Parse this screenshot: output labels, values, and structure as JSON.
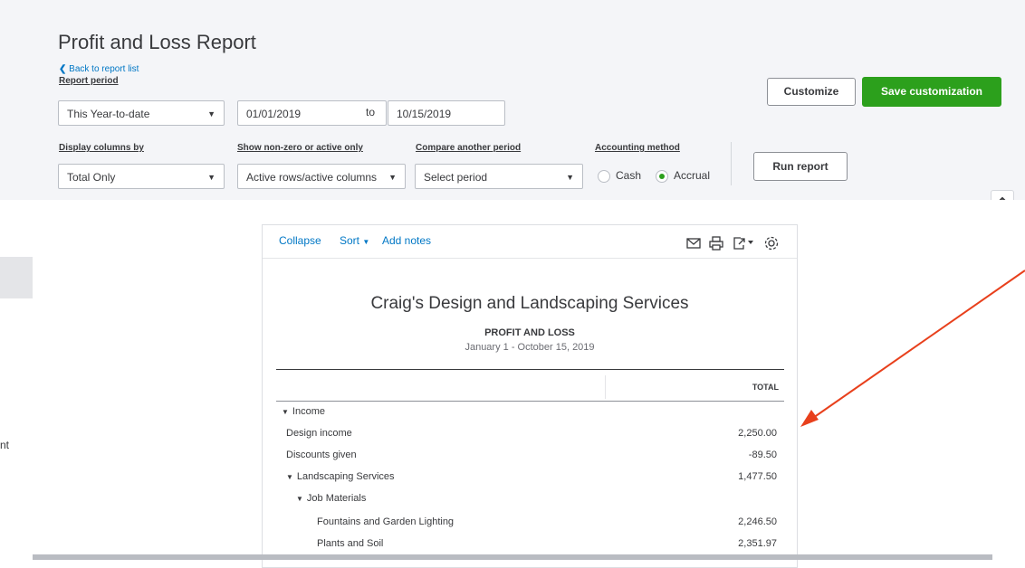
{
  "page": {
    "title": "Profit and Loss Report",
    "back_link": "Back to report list",
    "report_period_label": "Report period",
    "report_period_value": "This Year-to-date",
    "date_from": "01/01/2019",
    "to_text": "to",
    "date_to": "10/15/2019",
    "display_columns_label": "Display columns by",
    "display_columns_value": "Total Only",
    "show_nonzero_label": "Show non-zero or active only",
    "show_nonzero_value": "Active rows/active columns",
    "compare_label": "Compare another period",
    "compare_value": "Select period",
    "accounting_label": "Accounting method",
    "cash_label": "Cash",
    "accrual_label": "Accrual",
    "customize_btn": "Customize",
    "save_customization_btn": "Save customization",
    "run_report_btn": "Run report",
    "left_nav_fragment": "nt"
  },
  "report": {
    "toolbar": {
      "collapse": "Collapse",
      "sort": "Sort",
      "add_notes": "Add notes"
    },
    "company": "Craig's Design and Landscaping Services",
    "title": "PROFIT AND LOSS",
    "date_range": "January 1 - October 15, 2019",
    "column_header": "TOTAL",
    "rows": [
      {
        "label": "Income",
        "value": ""
      },
      {
        "label": "Design income",
        "value": "2,250.00"
      },
      {
        "label": "Discounts given",
        "value": "-89.50"
      },
      {
        "label": "Landscaping Services",
        "value": "1,477.50"
      },
      {
        "label": "Job Materials",
        "value": ""
      },
      {
        "label": "Fountains and Garden Lighting",
        "value": "2,246.50"
      },
      {
        "label": "Plants and Soil",
        "value": "2,351.97"
      }
    ]
  },
  "colors": {
    "accent_green": "#2ca01c",
    "link_blue": "#0077c5",
    "annotation_arrow": "#e8401c"
  }
}
